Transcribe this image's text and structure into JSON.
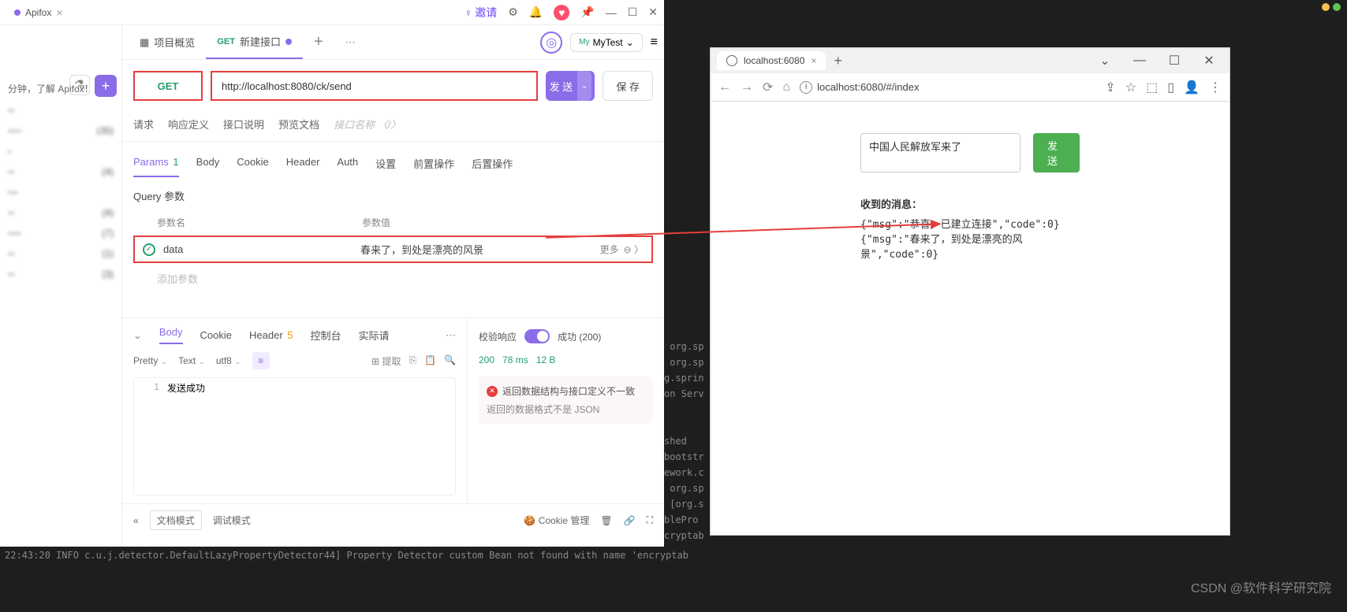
{
  "apifox": {
    "app_tab": "Apifox",
    "titlebar": {
      "invite": "邀请"
    },
    "project_tab": "项目概览",
    "new_api_tab": {
      "method": "GET",
      "label": "新建接口"
    },
    "env": {
      "prefix": "My",
      "name": "MyTest"
    },
    "request": {
      "method": "GET",
      "url": "http://localhost:8080/ck/send",
      "send": "发 送",
      "save": "保 存"
    },
    "subtabs": {
      "req": "请求",
      "resp_def": "响应定义",
      "api_desc": "接口说明",
      "preview": "预览文档",
      "api_name_ph": "接口名称 〈/〉"
    },
    "param_tabs": {
      "params": "Params",
      "params_count": "1",
      "body": "Body",
      "cookie": "Cookie",
      "header": "Header",
      "auth": "Auth",
      "settings": "设置",
      "pre": "前置操作",
      "post": "后置操作"
    },
    "query_title": "Query 参数",
    "param_head": {
      "name": "参数名",
      "value": "参数值"
    },
    "param_row": {
      "name": "data",
      "value": "春来了，到处是漂亮的风景",
      "more": "更多"
    },
    "add_param": "添加参数",
    "resp_tabs": {
      "body": "Body",
      "cookie": "Cookie",
      "header": "Header",
      "header_count": "5",
      "console": "控制台",
      "actual": "实际请"
    },
    "resp_format": {
      "pretty": "Pretty",
      "text": "Text",
      "utf8": "utf8",
      "extract": "提取"
    },
    "resp_body_line": "发送成功",
    "resp_right": {
      "validate": "校验响应",
      "success": "成功",
      "status": "(200)",
      "code": "200",
      "time": "78 ms",
      "size": "12 B",
      "err_title": "返回数据结构与接口定义不一致",
      "err_sub": "返回的数据格式不是 JSON"
    },
    "footer": {
      "doc_mode": "文档模式",
      "debug_mode": "调试模式",
      "cookie_mgmt": "Cookie 管理"
    },
    "sidebar_tip": "分钟，了解 Apifox！",
    "sidebar_items": [
      {
        "label": "",
        "count": ""
      },
      {
        "label": "",
        "count": "(35)"
      },
      {
        "label": "",
        "count": ""
      },
      {
        "label": "",
        "count": "(4)"
      },
      {
        "label": "",
        "count": ""
      },
      {
        "label": "",
        "count": "(4)"
      },
      {
        "label": "",
        "count": "(7)"
      },
      {
        "label": "",
        "count": "(1)"
      },
      {
        "label": "",
        "count": "(3)"
      }
    ]
  },
  "browser": {
    "tab_title": "localhost:6080",
    "url": "localhost:6080/#/index",
    "input_text": "中国人民解放军来了",
    "send": "发送",
    "msg_title": "收到的消息：",
    "msg1": "{\"msg\":\"恭喜，已建立连接\",\"code\":0}",
    "msg2": "{\"msg\":\"春来了，到处是漂亮的风景\",\"code\":0}"
  },
  "terminal": {
    "frag": " org.sp\n org.sp\ng.sprin\non Serv\n\n\nshed\nbootstr\nework.c\n org.sp\n [org.s\nblePro\ncryptab",
    "bottom": "22:43:20 INFO  c.u.j.detector.DefaultLazyPropertyDetector44] Property Detector custom Bean not found with name 'encryptab"
  },
  "watermark": "CSDN @软件科学研究院"
}
